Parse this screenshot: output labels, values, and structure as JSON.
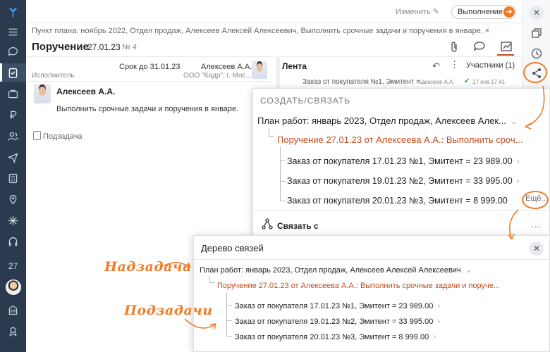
{
  "nav": {
    "date": "27"
  },
  "header": {
    "plan_line": "Пункт плана: ноябрь 2022, Отдел продаж, Алексеев Алексей Алексеевич, Выполнить срочные задачи и поручения в январе. ×",
    "title": "Поручение",
    "date": "27.01.23",
    "number": "№ 4",
    "change_label": "Изменить",
    "exec_label": "Выполнение"
  },
  "task": {
    "deadline": "Срок до 31.01.23",
    "executor_label": "Исполнитель",
    "author_name": "Алексеев А.А.",
    "author_org": "ООО \"Кадр\", г. Мос...",
    "executor_name": "Алексеев А.А.",
    "text": "Выполнить срочные задачи и поручения в январе.",
    "subtask_label": "Подзадача"
  },
  "feed": {
    "title": "Лента",
    "participants": "Участники (1)",
    "item": "Заказ от покупателя №1, Эмитент =...",
    "item_sub": "Алексеев А.А.",
    "item_time": "17 янв 17:41"
  },
  "create_link": {
    "header": "СОЗДАТЬ/СВЯЗАТЬ",
    "root": "План работ: январь 2023, Отдел продаж, Алексеев Алек...",
    "child": "Поручение 27.01.23 от Алексеева А.А.: Выполнить сроч...",
    "items": [
      "Заказ от покупателя 17.01.23 №1, Эмитент = 23 989.00",
      "Заказ от покупателя 19.01.23 №2, Эмитент = 33 995.00",
      "Заказ от покупателя 20.01.23 №3, Эмитент = 8 999.00"
    ],
    "more": "Ещё...",
    "link_with": "Связать с",
    "dots": "..."
  },
  "link_tree": {
    "title": "Дерево связей",
    "root": "План работ: январь 2023, Отдел продаж, Алексеев Алексей Алексеевич",
    "child": "Поручение 27.01.23 от Алексеева А.А.: Выполнить срочные задачи и поруче...",
    "items": [
      "Заказ от покупателя 17.01.23 №1, Эмитент = 23 989.00",
      "Заказ от покупателя 19.01.23 №2, Эмитент = 33 995.00",
      "Заказ от покупателя 20.01.23 №3, Эмитент = 8 999.00"
    ]
  },
  "annotations": {
    "supertask": "Надзадача",
    "subtasks": "Подзадачи"
  },
  "colors": {
    "nav_bg": "#2b3a4e",
    "accent": "#f07c2a",
    "link_orange": "#c14b1e"
  }
}
